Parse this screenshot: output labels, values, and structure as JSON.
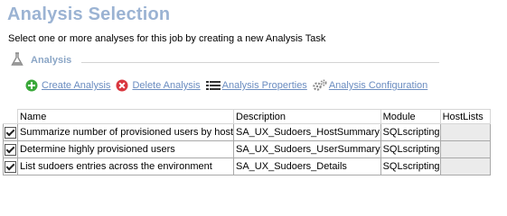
{
  "header": {
    "title": "Analysis Selection",
    "subtitle": "Select one or more analyses for this job by creating a new Analysis Task"
  },
  "section": {
    "label": "Analysis"
  },
  "toolbar": {
    "create_label": "Create Analysis",
    "delete_label": "Delete Analysis",
    "properties_label": "Analysis Properties",
    "configuration_label": "Analysis Configuration"
  },
  "table": {
    "columns": [
      "Name",
      "Description",
      "Module",
      "HostLists"
    ],
    "rows": [
      {
        "checked": true,
        "name": "Summarize number of provisioned users by host",
        "description": "SA_UX_Sudoers_HostSummary",
        "module": "SQLscripting",
        "hostlists": ""
      },
      {
        "checked": true,
        "name": "Determine highly provisioned users",
        "description": "SA_UX_Sudoers_UserSummary",
        "module": "SQLscripting",
        "hostlists": ""
      },
      {
        "checked": true,
        "name": "List sudoers entries across the environment",
        "description": "SA_UX_Sudoers_Details",
        "module": "SQLscripting",
        "hostlists": ""
      }
    ]
  },
  "colors": {
    "title": "#9bb3d3",
    "link": "#6a8cc0",
    "create_icon": "#3aa83a",
    "delete_icon": "#d9363e"
  }
}
